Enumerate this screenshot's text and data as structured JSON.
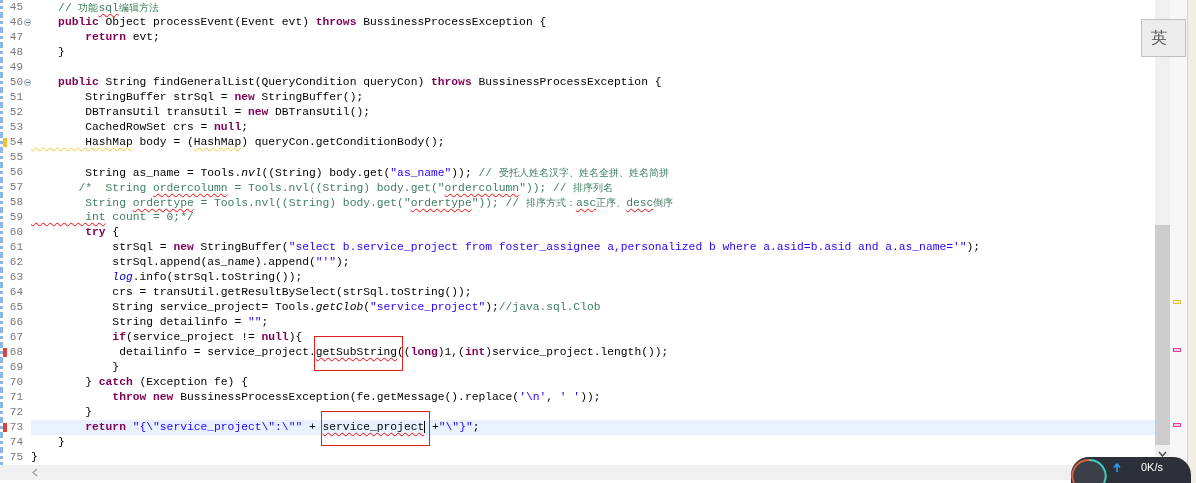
{
  "editor": {
    "lines": [
      {
        "number": "45",
        "current": false,
        "foldable": false,
        "error": false,
        "warning": false,
        "segments": [
          {
            "t": "    // ",
            "kind": "comment"
          },
          {
            "t": "功能",
            "kind": "note"
          },
          {
            "t": "sql",
            "kind": "commenttypo"
          },
          {
            "t": "编辑方法",
            "kind": "note"
          }
        ]
      },
      {
        "number": "46",
        "current": false,
        "foldable": true,
        "error": false,
        "warning": false,
        "segments": [
          {
            "t": "    public",
            "kind": "keyword"
          },
          {
            "t": " Object processEvent(Event evt) ",
            "kind": "plain"
          },
          {
            "t": "throws",
            "kind": "keyword"
          },
          {
            "t": " BussinessProcessException {",
            "kind": "plain"
          }
        ]
      },
      {
        "number": "47",
        "current": false,
        "foldable": false,
        "error": false,
        "warning": false,
        "segments": [
          {
            "t": "        return",
            "kind": "keyword"
          },
          {
            "t": " evt;",
            "kind": "plain"
          }
        ]
      },
      {
        "number": "48",
        "current": false,
        "foldable": false,
        "error": false,
        "warning": false,
        "segments": [
          {
            "t": "    }",
            "kind": "plain"
          }
        ]
      },
      {
        "number": "49",
        "current": false,
        "foldable": false,
        "error": false,
        "warning": false
      },
      {
        "number": "50",
        "current": false,
        "foldable": true,
        "error": false,
        "warning": false,
        "segments": [
          {
            "t": "    public",
            "kind": "keyword"
          },
          {
            "t": " String findGeneralList(QueryCondition queryCon) ",
            "kind": "plain"
          },
          {
            "t": "throws",
            "kind": "keyword"
          },
          {
            "t": " BussinessProcessException {",
            "kind": "plain"
          }
        ]
      },
      {
        "number": "51",
        "current": false,
        "foldable": false,
        "error": false,
        "warning": false,
        "segments": [
          {
            "t": "        StringBuffer strSql = ",
            "kind": "plain"
          },
          {
            "t": "new",
            "kind": "keyword"
          },
          {
            "t": " StringBuffer();",
            "kind": "plain"
          }
        ]
      },
      {
        "number": "52",
        "current": false,
        "foldable": false,
        "error": false,
        "warning": false,
        "segments": [
          {
            "t": "        DBTransUtil transUtil = ",
            "kind": "plain"
          },
          {
            "t": "new",
            "kind": "keyword"
          },
          {
            "t": " DBTransUtil();",
            "kind": "plain"
          }
        ]
      },
      {
        "number": "53",
        "current": false,
        "foldable": false,
        "error": false,
        "warning": false,
        "segments": [
          {
            "t": "        CachedRowSet crs = ",
            "kind": "plain"
          },
          {
            "t": "null",
            "kind": "keyword"
          },
          {
            "t": ";",
            "kind": "plain"
          }
        ]
      },
      {
        "number": "54",
        "current": false,
        "foldable": false,
        "error": false,
        "warning": true,
        "segments": [
          {
            "t": "        HashMap",
            "kind": "warned"
          },
          {
            "t": " body = (",
            "kind": "plain"
          },
          {
            "t": "HashMap",
            "kind": "warned"
          },
          {
            "t": ") queryCon.getConditionBody();",
            "kind": "plain"
          }
        ]
      },
      {
        "number": "55",
        "current": false,
        "foldable": false,
        "error": false,
        "warning": false
      },
      {
        "number": "56",
        "current": false,
        "foldable": false,
        "error": false,
        "warning": false,
        "segments": [
          {
            "t": "        String as_name = Tools.",
            "kind": "plain"
          },
          {
            "t": "nvl",
            "kind": "italic"
          },
          {
            "t": "((String) body.get(",
            "kind": "plain"
          },
          {
            "t": "\"as_name\"",
            "kind": "string"
          },
          {
            "t": ")); ",
            "kind": "plain"
          },
          {
            "t": "// ",
            "kind": "comment"
          },
          {
            "t": "受托人姓名汉字、姓名全拼、姓名简拼",
            "kind": "note"
          }
        ]
      },
      {
        "number": "57",
        "current": false,
        "foldable": false,
        "error": false,
        "warning": false,
        "segments": [
          {
            "t": "       /*  String ",
            "kind": "comment"
          },
          {
            "t": "ordercolumn",
            "kind": "commenttypo"
          },
          {
            "t": " = Tools.nvl((String) body.get(\"",
            "kind": "comment"
          },
          {
            "t": "ordercolumn",
            "kind": "commenttypo"
          },
          {
            "t": "\")); // ",
            "kind": "comment"
          },
          {
            "t": "排序列名",
            "kind": "note"
          }
        ]
      },
      {
        "number": "58",
        "current": false,
        "foldable": false,
        "error": false,
        "warning": false,
        "segments": [
          {
            "t": "        String ",
            "kind": "comment"
          },
          {
            "t": "ordertype",
            "kind": "commenttypo"
          },
          {
            "t": " = Tools.nvl((String) body.get(\"",
            "kind": "comment"
          },
          {
            "t": "ordertype",
            "kind": "commenttypo"
          },
          {
            "t": "\")); // ",
            "kind": "comment"
          },
          {
            "t": "排序方式：",
            "kind": "note"
          },
          {
            "t": "asc",
            "kind": "commenttypo"
          },
          {
            "t": "正序、",
            "kind": "note"
          },
          {
            "t": "desc",
            "kind": "commenttypo"
          },
          {
            "t": "倒序",
            "kind": "note"
          }
        ]
      },
      {
        "number": "59",
        "current": false,
        "foldable": false,
        "error": false,
        "warning": false,
        "segments": [
          {
            "t": "        int",
            "kind": "commenttypo"
          },
          {
            "t": " count = 0;*/",
            "kind": "comment"
          }
        ]
      },
      {
        "number": "60",
        "current": false,
        "foldable": false,
        "error": false,
        "warning": false,
        "segments": [
          {
            "t": "        try",
            "kind": "keyword"
          },
          {
            "t": " {",
            "kind": "plain"
          }
        ]
      },
      {
        "number": "61",
        "current": false,
        "foldable": false,
        "error": false,
        "warning": false,
        "segments": [
          {
            "t": "            strSql = ",
            "kind": "plain"
          },
          {
            "t": "new",
            "kind": "keyword"
          },
          {
            "t": " StringBuffer(",
            "kind": "plain"
          },
          {
            "t": "\"select b.service_project from foster_assignee a,personalized b where a.asid=b.asid and a.as_name='\"",
            "kind": "string"
          },
          {
            "t": ");",
            "kind": "plain"
          }
        ]
      },
      {
        "number": "62",
        "current": false,
        "foldable": false,
        "error": false,
        "warning": false,
        "segments": [
          {
            "t": "            strSql.append(as_name).append(",
            "kind": "plain"
          },
          {
            "t": "\"'\"",
            "kind": "string"
          },
          {
            "t": ");",
            "kind": "plain"
          }
        ]
      },
      {
        "number": "63",
        "current": false,
        "foldable": false,
        "error": false,
        "warning": false,
        "segments": [
          {
            "t": "            log",
            "kind": "field"
          },
          {
            "t": ".info(strSql.toString());",
            "kind": "plain"
          }
        ]
      },
      {
        "number": "64",
        "current": false,
        "foldable": false,
        "error": false,
        "warning": false,
        "segments": [
          {
            "t": "            crs = transUtil.getResultBySelect(strSql.toString());",
            "kind": "plain"
          }
        ]
      },
      {
        "number": "65",
        "current": false,
        "foldable": false,
        "error": false,
        "warning": false,
        "segments": [
          {
            "t": "            String service_project= Tools.",
            "kind": "plain"
          },
          {
            "t": "getClob",
            "kind": "italic"
          },
          {
            "t": "(",
            "kind": "plain"
          },
          {
            "t": "\"service_project\"",
            "kind": "string"
          },
          {
            "t": ");",
            "kind": "plain"
          },
          {
            "t": "//java.sql.Clob",
            "kind": "comment"
          }
        ]
      },
      {
        "number": "66",
        "current": false,
        "foldable": false,
        "error": false,
        "warning": false,
        "segments": [
          {
            "t": "            String detailinfo = ",
            "kind": "plain"
          },
          {
            "t": "\"\"",
            "kind": "string"
          },
          {
            "t": ";",
            "kind": "plain"
          }
        ]
      },
      {
        "number": "67",
        "current": false,
        "foldable": false,
        "error": false,
        "warning": false,
        "segments": [
          {
            "t": "            if",
            "kind": "keyword"
          },
          {
            "t": "(service_project != ",
            "kind": "plain"
          },
          {
            "t": "null",
            "kind": "keyword"
          },
          {
            "t": "){",
            "kind": "plain"
          }
        ]
      },
      {
        "number": "68",
        "current": false,
        "foldable": false,
        "error": true,
        "warning": false,
        "segments": [
          {
            "t": "             detailinfo = service_project.",
            "kind": "plain"
          },
          {
            "t": "getSubString",
            "kind": "boxed"
          },
          {
            "t": "((",
            "kind": "plain"
          },
          {
            "t": "long",
            "kind": "keyword"
          },
          {
            "t": ")1,(",
            "kind": "plain"
          },
          {
            "t": "int",
            "kind": "keyword"
          },
          {
            "t": ")service_project.length());",
            "kind": "plain"
          }
        ]
      },
      {
        "number": "69",
        "current": false,
        "foldable": false,
        "error": false,
        "warning": false,
        "segments": [
          {
            "t": "            }",
            "kind": "plain"
          }
        ]
      },
      {
        "number": "70",
        "current": false,
        "foldable": false,
        "error": false,
        "warning": false,
        "segments": [
          {
            "t": "        } ",
            "kind": "plain"
          },
          {
            "t": "catch",
            "kind": "keyword"
          },
          {
            "t": " (Exception fe) {",
            "kind": "plain"
          }
        ]
      },
      {
        "number": "71",
        "current": false,
        "foldable": false,
        "error": false,
        "warning": false,
        "segments": [
          {
            "t": "            throw new",
            "kind": "keyword"
          },
          {
            "t": " BussinessProcessException(fe.getMessage().replace(",
            "kind": "plain"
          },
          {
            "t": "'\\n'",
            "kind": "string"
          },
          {
            "t": ", ",
            "kind": "plain"
          },
          {
            "t": "' '",
            "kind": "string"
          },
          {
            "t": "));",
            "kind": "plain"
          }
        ]
      },
      {
        "number": "72",
        "current": false,
        "foldable": false,
        "error": false,
        "warning": false,
        "segments": [
          {
            "t": "        }",
            "kind": "plain"
          }
        ]
      },
      {
        "number": "73",
        "current": true,
        "foldable": false,
        "error": true,
        "warning": false,
        "segments": [
          {
            "t": "        return ",
            "kind": "keyword"
          },
          {
            "t": "\"{\\\"service_project\\\":\\\"\"",
            "kind": "string"
          },
          {
            "t": " + ",
            "kind": "plain"
          },
          {
            "t": "service_project",
            "kind": "boxedcaret"
          },
          {
            "t": " +",
            "kind": "plain"
          },
          {
            "t": "\"\\\"}\"",
            "kind": "string"
          },
          {
            "t": ";",
            "kind": "plain"
          }
        ]
      },
      {
        "number": "74",
        "current": false,
        "foldable": false,
        "error": false,
        "warning": false,
        "segments": [
          {
            "t": "    }",
            "kind": "plain"
          }
        ]
      },
      {
        "number": "75",
        "current": false,
        "foldable": false,
        "error": false,
        "warning": false,
        "segments": [
          {
            "t": "}",
            "kind": "plain"
          }
        ]
      }
    ]
  },
  "ime_indicator": {
    "label": "英"
  },
  "net_monitor": {
    "speed": "0K/s"
  }
}
